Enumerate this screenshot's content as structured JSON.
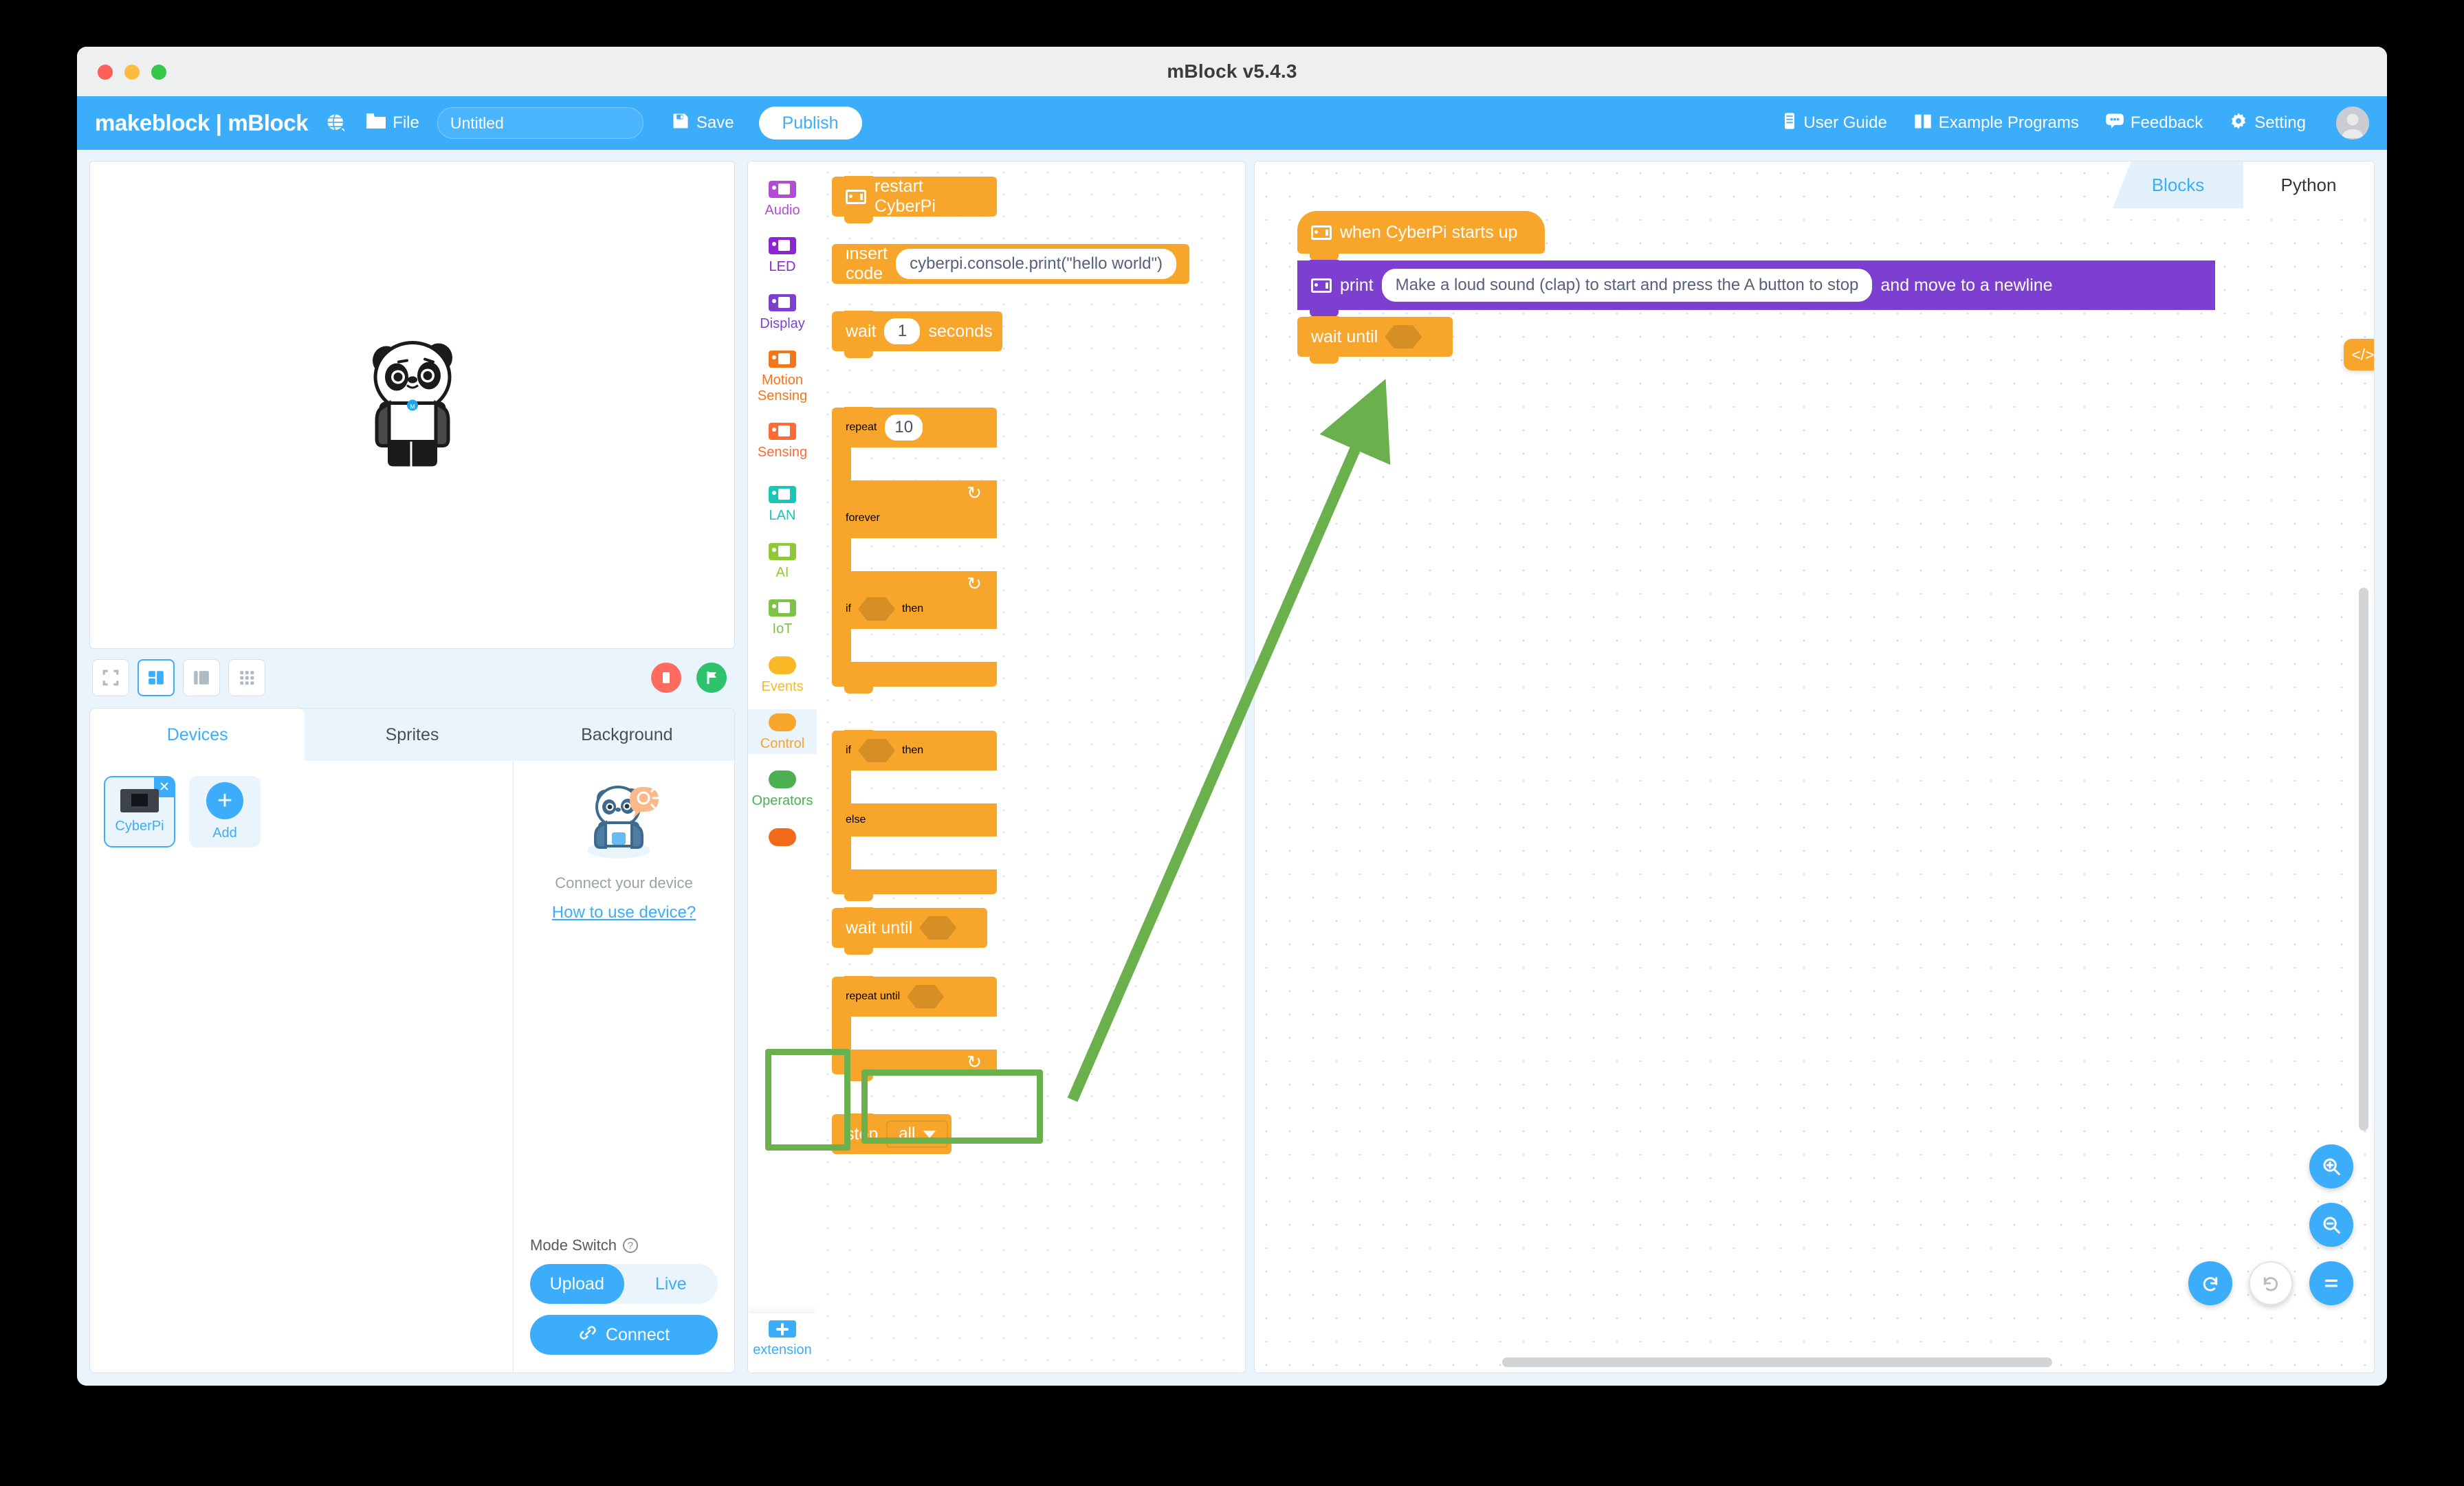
{
  "window": {
    "title": "mBlock v5.4.3"
  },
  "toolbar": {
    "brand": "makeblock | mBlock",
    "globe_icon": "globe-icon",
    "file_icon": "folder-icon",
    "file_label": "File",
    "project_title_value": "Untitled",
    "project_title_placeholder": "Untitled",
    "save_icon": "save-disk-icon",
    "save_label": "Save",
    "publish_label": "Publish",
    "right_items": [
      {
        "icon": "book-icon",
        "label": "User Guide"
      },
      {
        "icon": "open-book-icon",
        "label": "Example Programs"
      },
      {
        "icon": "chat-bubble-icon",
        "label": "Feedback"
      },
      {
        "icon": "gear-icon",
        "label": "Setting"
      }
    ],
    "avatar_icon": "avatar-icon",
    "accent_color": "#3cadfb"
  },
  "stage": {
    "sprite_icon": "panda-sprite",
    "layout_buttons": [
      {
        "icon": "fullscreen-icon",
        "active": false
      },
      {
        "icon": "split-layout-icon",
        "active": true
      },
      {
        "icon": "small-stage-icon",
        "active": false
      },
      {
        "icon": "grid-layout-icon",
        "active": false
      }
    ],
    "stop_icon": "stop-icon",
    "flag_icon": "green-flag-icon",
    "stop_color": "#ff6b5e",
    "flag_color": "#2dc26b"
  },
  "left_panel": {
    "tabs": [
      {
        "label": "Devices",
        "active": true
      },
      {
        "label": "Sprites",
        "active": false
      },
      {
        "label": "Background",
        "active": false
      }
    ],
    "device": {
      "name": "CyberPi",
      "close_icon": "close-icon",
      "thumb_icon": "cyberpi-board-icon"
    },
    "add": {
      "label": "Add",
      "icon": "plus-icon"
    },
    "connect_hint": "Connect your device",
    "how_to_link": "How to use device?",
    "mode_switch_label": "Mode Switch",
    "mode_help_icon": "question-mark-icon",
    "modes": [
      {
        "label": "Upload",
        "active": true
      },
      {
        "label": "Live",
        "active": false
      }
    ],
    "connect_button": {
      "label": "Connect",
      "icon": "link-icon"
    }
  },
  "palette": {
    "categories": [
      {
        "label": "Audio",
        "color": "#b44bd6",
        "shape": "device",
        "selected": false
      },
      {
        "label": "LED",
        "color": "#8e24d4",
        "shape": "device",
        "selected": false
      },
      {
        "label": "Display",
        "color": "#7d3fd0",
        "shape": "device",
        "selected": false
      },
      {
        "label": "Motion Sensing",
        "color": "#f5761a",
        "shape": "device",
        "selected": false
      },
      {
        "label": "Sensing",
        "color": "#ff6b33",
        "shape": "device",
        "selected": false
      },
      {
        "label": "LAN",
        "color": "#18c7b6",
        "shape": "device",
        "selected": false
      },
      {
        "label": "AI",
        "color": "#8fc93a",
        "shape": "device",
        "selected": false
      },
      {
        "label": "IoT",
        "color": "#7ec24a",
        "shape": "device",
        "selected": false
      },
      {
        "label": "Events",
        "color": "#f9b825",
        "shape": "round",
        "selected": false
      },
      {
        "label": "Control",
        "color": "#f7a62b",
        "shape": "round",
        "selected": true
      },
      {
        "label": "Operators",
        "color": "#4caf50",
        "shape": "round",
        "selected": false
      },
      {
        "label": "",
        "color": "#f2691a",
        "shape": "round",
        "selected": false
      }
    ],
    "extension": {
      "label": "extension",
      "icon": "plus-icon"
    },
    "blocks": [
      {
        "type": "stack",
        "text": "restart CyberPi",
        "icon": "cyberpi-icon"
      },
      {
        "type": "stack",
        "text": "insert code",
        "icon": "cyberpi-icon",
        "field": "cyberpi.console.print(\"hello world\")"
      },
      {
        "type": "stack",
        "text_before": "wait",
        "value": "1",
        "text_after": "seconds"
      },
      {
        "type": "c",
        "text_before": "repeat",
        "value": "10"
      },
      {
        "type": "c",
        "text_before": "forever"
      },
      {
        "type": "c",
        "text_before": "if",
        "text_after": "then",
        "slot": "boolean"
      },
      {
        "type": "c-else",
        "text_before": "if",
        "text_after": "then",
        "else_label": "else",
        "slot": "boolean"
      },
      {
        "type": "stack",
        "text_before": "wait until",
        "slot": "boolean",
        "highlighted": true
      },
      {
        "type": "c",
        "text_before": "repeat until",
        "slot": "boolean"
      },
      {
        "type": "stack",
        "text_before": "stop",
        "dropdown": "all"
      }
    ]
  },
  "workspace": {
    "tabs": [
      {
        "label": "Blocks",
        "active": true
      },
      {
        "label": "Python",
        "active": false
      }
    ],
    "code_toggle_icon": "code-brackets-icon",
    "script": [
      {
        "kind": "hat",
        "color": "#f7a62b",
        "icon": "cyberpi-icon",
        "text": "when CyberPi starts up"
      },
      {
        "kind": "stack",
        "color": "#7d3fd0",
        "icon": "cyberpi-icon",
        "text_before": "print",
        "field": "Make a loud sound (clap) to start and press the A button to stop",
        "text_after": "and move to a newline"
      },
      {
        "kind": "stack",
        "color": "#f7a62b",
        "text_before": "wait until",
        "slot": "boolean"
      }
    ],
    "fabs": [
      {
        "icon": "zoom-in-icon"
      },
      {
        "icon": "zoom-out-icon"
      },
      {
        "icon": "zoom-reset-icon"
      },
      {
        "icon": "undo-icon"
      },
      {
        "icon": "redo-icon"
      }
    ]
  },
  "annotations": {
    "highlight_color": "#6ab04c",
    "arrow": "points from the 'wait until' palette block to the script area",
    "highlighted_category": "Control",
    "highlighted_block": "wait until"
  }
}
